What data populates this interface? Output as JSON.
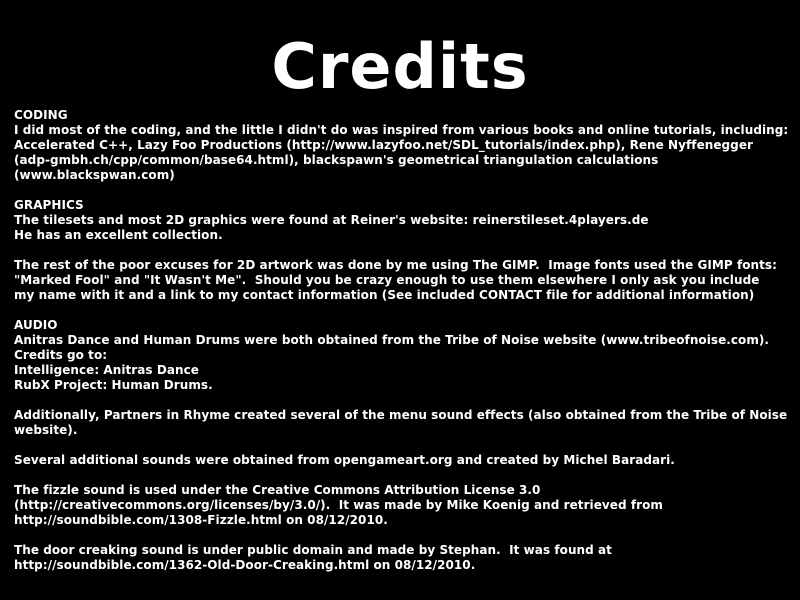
{
  "screen": {
    "title": "Credits",
    "background_color": "#000000",
    "text_color": "#ffffff"
  },
  "sections": {
    "coding": {
      "heading": "CODING",
      "lines": [
        "I did most of the coding, and the little I didn't do was inspired from various books and online tutorials, including:",
        "Accelerated C++, Lazy Foo Productions (http://www.lazyfoo.net/SDL_tutorials/index.php), Rene Nyffenegger",
        "(adp-gmbh.ch/cpp/common/base64.html), blackspawn's geometrical triangulation calculations",
        "(www.blackspwan.com)"
      ]
    },
    "graphics": {
      "heading": "GRAPHICS",
      "lines": [
        "The tilesets and most 2D graphics were found at Reiner's website: reinerstileset.4players.de",
        "He has an excellent collection."
      ],
      "extra_lines": [
        "The rest of the poor excuses for 2D artwork was done by me using The GIMP.  Image fonts used the GIMP fonts:",
        "\"Marked Fool\" and \"It Wasn't Me\".  Should you be crazy enough to use them elsewhere I only ask you include",
        "my name with it and a link to my contact information (See included CONTACT file for additional information)"
      ]
    },
    "audio": {
      "heading": "AUDIO",
      "lines": [
        "Anitras Dance and Human Drums were both obtained from the Tribe of Noise website (www.tribeofnoise.com).",
        "Credits go to:",
        "Intelligence: Anitras Dance",
        "RubX Project: Human Drums."
      ],
      "partners": [
        "Additionally, Partners in Rhyme created several of the menu sound effects (also obtained from the Tribe of Noise",
        "website)."
      ],
      "opengameart": [
        "Several additional sounds were obtained from opengameart.org and created by Michel Baradari."
      ],
      "fizzle": [
        "The fizzle sound is used under the Creative Commons Attribution License 3.0",
        "(http://creativecommons.org/licenses/by/3.0/).  It was made by Mike Koenig and retrieved from",
        "http://soundbible.com/1308-Fizzle.html on 08/12/2010."
      ],
      "door": [
        "The door creaking sound is under public domain and made by Stephan.  It was found at",
        "http://soundbible.com/1362-Old-Door-Creaking.html on 08/12/2010."
      ]
    }
  }
}
